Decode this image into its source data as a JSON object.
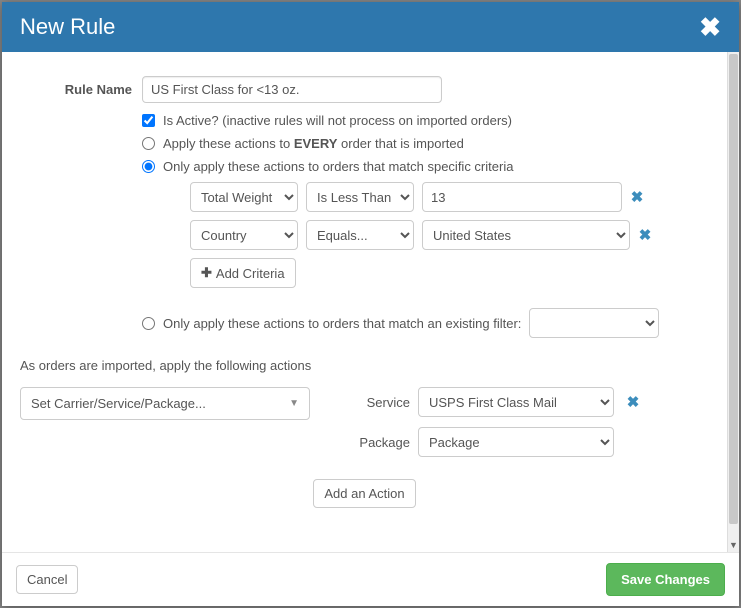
{
  "header": {
    "title": "New Rule"
  },
  "form": {
    "rule_name_label": "Rule Name",
    "rule_name_value": "US First Class for <13 oz.",
    "is_active_checked": true,
    "is_active_label": "Is Active? (inactive rules will not process on imported orders)",
    "apply_mode": "criteria",
    "apply_every_label_pre": "Apply these actions to ",
    "apply_every_label_strong": "EVERY",
    "apply_every_label_post": " order that is imported",
    "apply_criteria_label": "Only apply these actions to orders that match specific criteria",
    "criteria": [
      {
        "field": "Total Weight",
        "operator": "Is Less Than",
        "value": "13",
        "value_type": "text"
      },
      {
        "field": "Country",
        "operator": "Equals...",
        "value": "United States",
        "value_type": "select"
      }
    ],
    "add_criteria_label": "Add Criteria",
    "apply_filter_label": "Only apply these actions to orders that match an existing filter:",
    "filter_value": ""
  },
  "actions_intro": "As orders are imported, apply the following actions",
  "action": {
    "type_label": "Set Carrier/Service/Package...",
    "service_label": "Service",
    "service_value": "USPS First Class Mail",
    "package_label": "Package",
    "package_value": "Package"
  },
  "add_action_label": "Add an Action",
  "footer": {
    "cancel": "Cancel",
    "save": "Save Changes"
  }
}
